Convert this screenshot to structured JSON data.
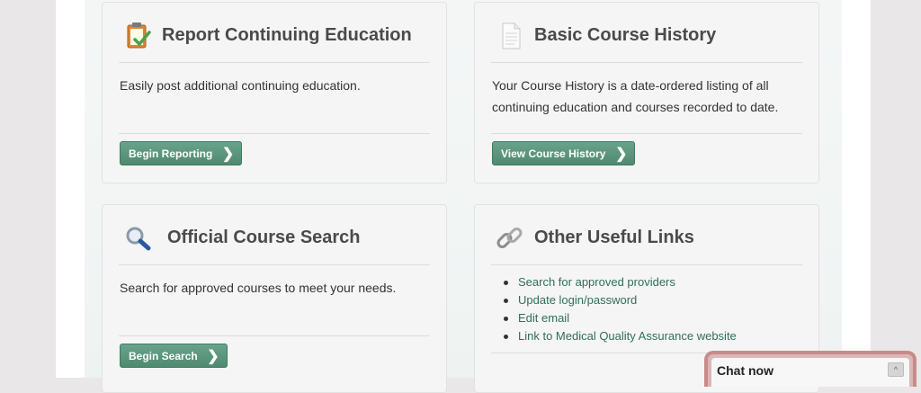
{
  "cards": {
    "report": {
      "title": "Report Continuing Education",
      "icon": "clipboard-check-icon",
      "text": "Easily post additional continuing education.",
      "button": "Begin Reporting"
    },
    "history": {
      "title": "Basic Course History",
      "icon": "document-icon",
      "text": "Your Course History is a date-ordered listing of all continuing education and courses recorded to date.",
      "button": "View Course History"
    },
    "search": {
      "title": "Official Course Search",
      "icon": "magnifier-icon",
      "text": "Search for approved courses to meet your needs.",
      "button": "Begin Search"
    },
    "links": {
      "title": "Other Useful Links",
      "icon": "chain-link-icon",
      "items": [
        "Search for approved providers",
        "Update login/password",
        "Edit email",
        "Link to Medical Quality Assurance website"
      ]
    }
  },
  "chevron": "❯",
  "chat": {
    "label": "Chat now",
    "toggle": "^"
  },
  "colors": {
    "button": "#5a957b",
    "link": "#2f6f57",
    "title": "#4a4a4a"
  }
}
